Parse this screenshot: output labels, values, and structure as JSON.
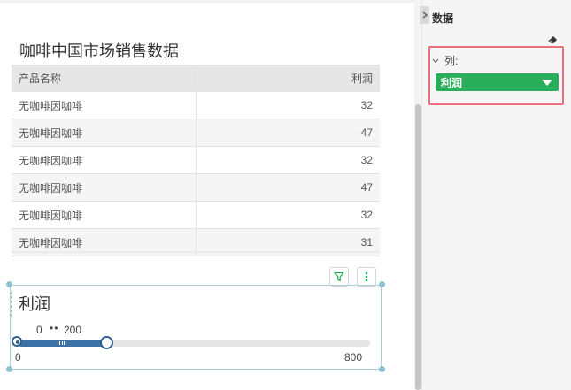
{
  "table": {
    "title": "咖啡中国市场销售数据",
    "columns": [
      "产品名称",
      "利润"
    ],
    "rows": [
      [
        "无咖啡因咖啡",
        "32"
      ],
      [
        "无咖啡因咖啡",
        "47"
      ],
      [
        "无咖啡因咖啡",
        "32"
      ],
      [
        "无咖啡因咖啡",
        "47"
      ],
      [
        "无咖啡因咖啡",
        "32"
      ],
      [
        "无咖啡因咖啡",
        "31"
      ]
    ]
  },
  "toolbar": {
    "filter_icon": "filter-icon",
    "more_icon": "more-vertical-icon"
  },
  "slider": {
    "title": "利润",
    "selected_low": "0",
    "separator": "••",
    "selected_high": "200",
    "min_label": "0",
    "max_label": "800",
    "min": 0,
    "max": 800,
    "low": 0,
    "high": 200
  },
  "panel": {
    "title": "数据",
    "column_label": "列:",
    "field": "利润"
  },
  "colors": {
    "slider_fill": "#3d72a6",
    "field_pill": "#2aae5b",
    "highlight_border": "#e8707a",
    "selection_border": "#a9d0db"
  }
}
